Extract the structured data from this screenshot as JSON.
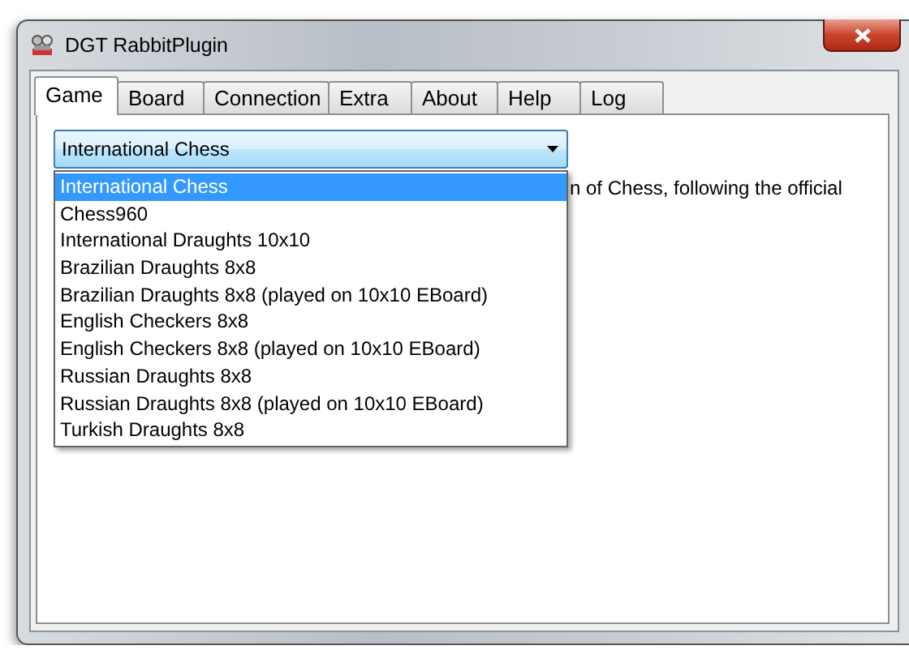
{
  "window": {
    "title": "DGT RabbitPlugin"
  },
  "tabs": [
    {
      "label": "Game",
      "selected": true
    },
    {
      "label": "Board",
      "selected": false
    },
    {
      "label": "Connection",
      "selected": false
    },
    {
      "label": "Extra",
      "selected": false
    },
    {
      "label": "About",
      "selected": false
    },
    {
      "label": "Help",
      "selected": false
    },
    {
      "label": "Log",
      "selected": false
    }
  ],
  "game_select": {
    "value": "International Chess",
    "expanded": true,
    "options": [
      {
        "label": "International Chess",
        "selected": true
      },
      {
        "label": "Chess960",
        "selected": false
      },
      {
        "label": "International Draughts 10x10",
        "selected": false
      },
      {
        "label": "Brazilian Draughts 8x8",
        "selected": false
      },
      {
        "label": "Brazilian Draughts 8x8 (played on 10x10 EBoard)",
        "selected": false
      },
      {
        "label": "English Checkers 8x8",
        "selected": false
      },
      {
        "label": "English Checkers 8x8 (played on 10x10 EBoard)",
        "selected": false
      },
      {
        "label": "Russian Draughts 8x8",
        "selected": false
      },
      {
        "label": "Russian Draughts 8x8 (played on 10x10 EBoard)",
        "selected": false
      },
      {
        "label": "Turkish Draughts 8x8",
        "selected": false
      }
    ]
  },
  "description": "n of Chess, following the official"
}
